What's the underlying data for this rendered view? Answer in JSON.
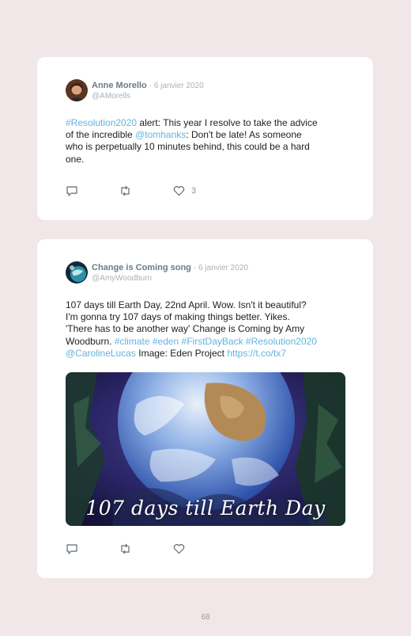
{
  "tweets": [
    {
      "name": "Anne Morello",
      "date": "· 6 janvier 2020",
      "handle": "@AMorells",
      "lines": [
        [
          {
            "t": "#Resolution2020",
            "link": true
          },
          {
            "t": " alert: This year I resolve to take the advice",
            "link": false
          }
        ],
        [
          {
            "t": "of the incredible ",
            "link": false
          },
          {
            "t": "@tomhanks",
            "link": true
          },
          {
            "t": ": Don't be late! As someone",
            "link": false
          }
        ],
        [
          {
            "t": "who is perpetually 10 minutes behind, this could be a hard",
            "link": false
          }
        ],
        [
          {
            "t": "one.",
            "link": false
          }
        ]
      ],
      "like_count": "3"
    },
    {
      "name": "Change is Coming song",
      "date": "· 6 janvier 2020",
      "handle": "@AmyWoodburn",
      "lines": [
        [
          {
            "t": "107 days till Earth Day, 22nd April. Wow. Isn't it beautiful?",
            "link": false
          }
        ],
        [
          {
            "t": "I'm gonna try 107 days of making things better. Yikes.",
            "link": false
          }
        ],
        [
          {
            "t": "'There has to be another way' Change is Coming by Amy",
            "link": false
          }
        ],
        [
          {
            "t": "Woodburn. ",
            "link": false
          },
          {
            "t": "#climate #eden #FirstDayBack #Resolution2020",
            "link": true
          }
        ],
        [
          {
            "t": "@CarolineLucas",
            "link": true
          },
          {
            "t": " Image: Eden Project ",
            "link": false
          },
          {
            "t": "https://t.co/tx7",
            "link": true
          }
        ]
      ],
      "media_caption": "107 days till Earth Day",
      "like_count": ""
    }
  ],
  "icons": {
    "reply": "reply-icon",
    "retweet": "retweet-icon",
    "like": "heart-icon"
  },
  "colors": {
    "background": "#f1e6e8",
    "card": "#ffffff",
    "link": "#60b4df",
    "name": "#6c7a86",
    "meta": "#a9b2ba"
  },
  "page_number": "68"
}
